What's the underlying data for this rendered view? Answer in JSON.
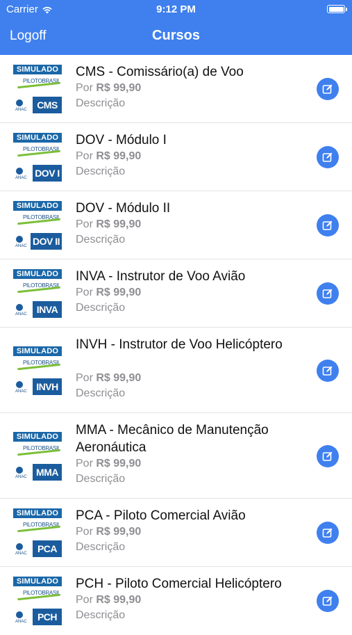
{
  "status_bar": {
    "carrier": "Carrier",
    "time": "9:12 PM"
  },
  "nav": {
    "left_button": "Logoff",
    "title": "Cursos"
  },
  "courses": [
    {
      "title": "CMS - Comissário(a) de Voo",
      "price_prefix": "Por",
      "price": "R$ 99,90",
      "description": "Descrição",
      "badge": "SIMULADO",
      "brand": "PILOTOBRASIL",
      "code": "CMS",
      "agency": "ANAC"
    },
    {
      "title": "DOV - Módulo I",
      "price_prefix": "Por",
      "price": "R$ 99,90",
      "description": "Descrição",
      "badge": "SIMULADO",
      "brand": "PILOTOBRASIL",
      "code": "DOV I",
      "agency": "ANAC"
    },
    {
      "title": "DOV - Módulo II",
      "price_prefix": "Por",
      "price": "R$ 99,90",
      "description": "Descrição",
      "badge": "SIMULADO",
      "brand": "PILOTOBRASIL",
      "code": "DOV II",
      "agency": "ANAC"
    },
    {
      "title": "INVA - Instrutor de Voo Avião",
      "price_prefix": "Por",
      "price": "R$ 99,90",
      "description": "Descrição",
      "badge": "SIMULADO",
      "brand": "PILOTOBRASIL",
      "code": "INVA",
      "agency": "ANAC"
    },
    {
      "title": "INVH - Instrutor de Voo Helicóptero",
      "price_prefix": "Por",
      "price": "R$ 99,90",
      "description": "Descrição",
      "badge": "SIMULADO",
      "brand": "PILOTOBRASIL",
      "code": "INVH",
      "agency": "ANAC"
    },
    {
      "title": "MMA - Mecânico de Manutenção Aeronáutica",
      "price_prefix": "Por",
      "price": "R$ 99,90",
      "description": "Descrição",
      "badge": "SIMULADO",
      "brand": "PILOTOBRASIL",
      "code": "MMA",
      "agency": "ANAC"
    },
    {
      "title": "PCA - Piloto Comercial Avião",
      "price_prefix": "Por",
      "price": "R$ 99,90",
      "description": "Descrição",
      "badge": "SIMULADO",
      "brand": "PILOTOBRASIL",
      "code": "PCA",
      "agency": "ANAC"
    },
    {
      "title": "PCH - Piloto Comercial Helicóptero",
      "price_prefix": "Por",
      "price": "R$ 99,90",
      "description": "Descrição",
      "badge": "SIMULADO",
      "brand": "PILOTOBRASIL",
      "code": "PCH",
      "agency": "ANAC"
    }
  ],
  "icons": {
    "row_action": "edit-icon",
    "wifi": "wifi-icon",
    "battery": "battery-icon"
  },
  "colors": {
    "accent": "#3f80ee",
    "secondary_text": "#8e8e93"
  }
}
